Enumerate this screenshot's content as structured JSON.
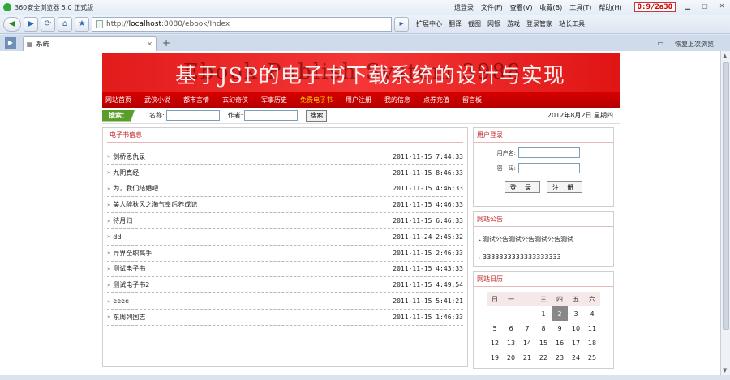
{
  "browser": {
    "title": "360安全浏览器 5.0 正式版",
    "menus": [
      "遗登录",
      "文件(F)",
      "查看(V)",
      "收藏(B)",
      "工具(T)",
      "帮助(H)"
    ],
    "clock": "0:9/2a30",
    "url_prefix": "http://",
    "url_host": "localhost",
    "url_rest": ":8080/ebook/Index",
    "toolbar": [
      "扩展中心",
      "翻译",
      "截图",
      "网银",
      "游戏",
      "登录管家",
      "站长工具"
    ],
    "tab_title": "系统",
    "restore_label": "恢复上次浏览"
  },
  "site": {
    "banner_title": "基于JSP的电子书下载系统的设计与实现",
    "banner_overlay": "Ebook Publish System 3988",
    "nav": [
      "网站首页",
      "武侠小说",
      "都市言情",
      "玄幻奇侠",
      "军事历史",
      "免费电子书",
      "用户注册",
      "我的信息",
      "点券充值",
      "留言板"
    ],
    "search": {
      "tag": "搜索：",
      "name_label": "名称:",
      "author_label": "作者:",
      "button": "搜索",
      "date": "2012年8月2日  星期四"
    },
    "books": {
      "title": "电子书信息",
      "items": [
        {
          "name": "剑桥恩仇录",
          "time": "2011-11-15 7:44:33"
        },
        {
          "name": "九阴真经",
          "time": "2011-11-15 8:46:33"
        },
        {
          "name": "为，我们结婚吧",
          "time": "2011-11-15 4:46:33"
        },
        {
          "name": "美人醉秋风之淘气皇后养成记",
          "time": "2011-11-15 4:46:33"
        },
        {
          "name": "待月归",
          "time": "2011-11-15 6:46:33"
        },
        {
          "name": "dd",
          "time": "2011-11-24 2:45:32"
        },
        {
          "name": "异界全职高手",
          "time": "2011-11-15 2:46:33"
        },
        {
          "name": "测试电子书",
          "time": "2011-11-15 4:43:33"
        },
        {
          "name": "测试电子书2",
          "time": "2011-11-15 4:49:54"
        },
        {
          "name": "eeee",
          "time": "2011-11-15 5:41:21"
        },
        {
          "name": "东周列国志",
          "time": "2011-11-15 1:46:33"
        }
      ]
    },
    "login": {
      "title": "用户登录",
      "username_label": "用户名:",
      "password_label": "密　码:",
      "login_button": "登 录",
      "register_button": "注 册"
    },
    "notice": {
      "title": "网站公告",
      "items": [
        "测试公告测试公告测试公告测试",
        "3333333333333333333"
      ]
    },
    "calendar": {
      "title": "网站日历",
      "weekdays": [
        "日",
        "一",
        "二",
        "三",
        "四",
        "五",
        "六"
      ],
      "weeks": [
        [
          "",
          "",
          "",
          "1",
          "2",
          "3",
          "4"
        ],
        [
          "5",
          "6",
          "7",
          "8",
          "9",
          "10",
          "11"
        ],
        [
          "12",
          "13",
          "14",
          "15",
          "16",
          "17",
          "18"
        ],
        [
          "19",
          "20",
          "21",
          "22",
          "23",
          "24",
          "25"
        ]
      ],
      "today": "2"
    }
  }
}
